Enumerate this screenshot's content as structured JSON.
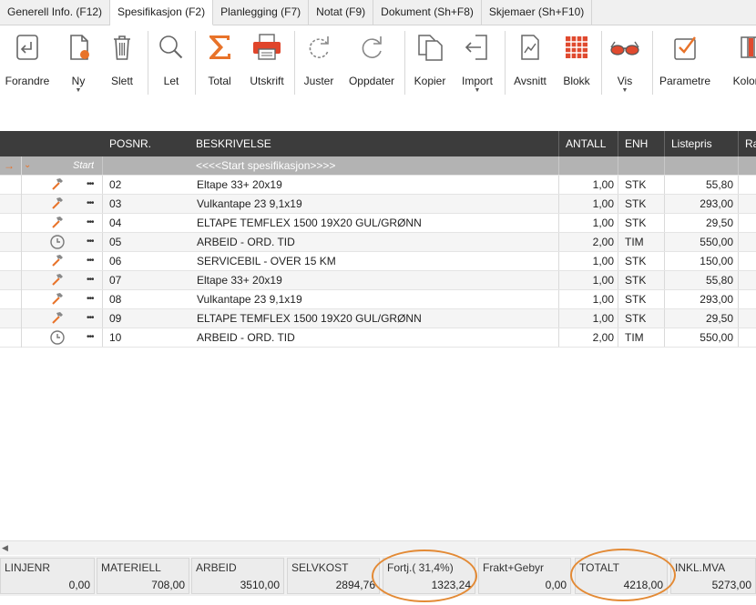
{
  "tabs": [
    {
      "label": "Generell Info. (F12)",
      "active": false
    },
    {
      "label": "Spesifikasjon (F2)",
      "active": true
    },
    {
      "label": "Planlegging (F7)",
      "active": false
    },
    {
      "label": "Notat (F9)",
      "active": false
    },
    {
      "label": "Dokument (Sh+F8)",
      "active": false
    },
    {
      "label": "Skjemaer (Sh+F10)",
      "active": false
    }
  ],
  "toolbar": {
    "forandre": "Forandre",
    "ny": "Ny",
    "slett": "Slett",
    "let": "Let",
    "total": "Total",
    "utskrift": "Utskrift",
    "juster": "Juster",
    "oppdater": "Oppdater",
    "kopier": "Kopier",
    "import": "Import",
    "avsnitt": "Avsnitt",
    "blokk": "Blokk",
    "vis": "Vis",
    "parametre": "Parametre",
    "kolonner": "Kolon"
  },
  "grid": {
    "headers": {
      "posnr": "POSNR.",
      "beskrivelse": "BESKRIVELSE",
      "antall": "ANTALL",
      "enh": "ENH",
      "listepris": "Listepris",
      "rabatt": "Ra"
    },
    "start_row": {
      "label": "Start",
      "text": "<<<<Start spesifikasjon>>>>"
    },
    "rows": [
      {
        "icon": "hammer-icon",
        "posnr": "02",
        "beskrivelse": "Eltape 33+ 20x19",
        "antall": "1,00",
        "enh": "STK",
        "listepris": "55,80"
      },
      {
        "icon": "hammer-icon",
        "posnr": "03",
        "beskrivelse": "Vulkantape 23 9,1x19",
        "antall": "1,00",
        "enh": "STK",
        "listepris": "293,00"
      },
      {
        "icon": "hammer-icon",
        "posnr": "04",
        "beskrivelse": "ELTAPE TEMFLEX 1500 19X20 GUL/GRØNN",
        "antall": "1,00",
        "enh": "STK",
        "listepris": "29,50"
      },
      {
        "icon": "clock-icon",
        "posnr": "05",
        "beskrivelse": "ARBEID - ORD. TID",
        "antall": "2,00",
        "enh": "TIM",
        "listepris": "550,00"
      },
      {
        "icon": "hammer-icon",
        "posnr": "06",
        "beskrivelse": "SERVICEBIL - OVER 15 KM",
        "antall": "1,00",
        "enh": "STK",
        "listepris": "150,00"
      },
      {
        "icon": "hammer-icon",
        "posnr": "07",
        "beskrivelse": "Eltape 33+ 20x19",
        "antall": "1,00",
        "enh": "STK",
        "listepris": "55,80"
      },
      {
        "icon": "hammer-icon",
        "posnr": "08",
        "beskrivelse": "Vulkantape 23 9,1x19",
        "antall": "1,00",
        "enh": "STK",
        "listepris": "293,00"
      },
      {
        "icon": "hammer-icon",
        "posnr": "09",
        "beskrivelse": "ELTAPE TEMFLEX 1500 19X20 GUL/GRØNN",
        "antall": "1,00",
        "enh": "STK",
        "listepris": "29,50"
      },
      {
        "icon": "clock-icon",
        "posnr": "10",
        "beskrivelse": "ARBEID - ORD. TID",
        "antall": "2,00",
        "enh": "TIM",
        "listepris": "550,00"
      }
    ]
  },
  "footer": {
    "linjenr": {
      "label": "LINJENR",
      "value": "0,00"
    },
    "materiell": {
      "label": "MATERIELL",
      "value": "708,00"
    },
    "arbeid": {
      "label": "ARBEID",
      "value": "3510,00"
    },
    "selvkost": {
      "label": "SELVKOST",
      "value": "2894,76"
    },
    "fortj": {
      "label": "Fortj.( 31,4%)",
      "value": "1323,24"
    },
    "frakt": {
      "label": "Frakt+Gebyr",
      "value": "0,00"
    },
    "totalt": {
      "label": "TOTALT",
      "value": "4218,00"
    },
    "inkl": {
      "label": "INKL.MVA",
      "value": "5273,00"
    }
  },
  "colors": {
    "accent_orange": "#e38a35",
    "header_dark": "#3c3c3c",
    "start_row_gray": "#b3b3b3",
    "sigma_orange": "#e8732a",
    "printer_red": "#e0452b",
    "grid_icon_red": "#e04a2f"
  }
}
